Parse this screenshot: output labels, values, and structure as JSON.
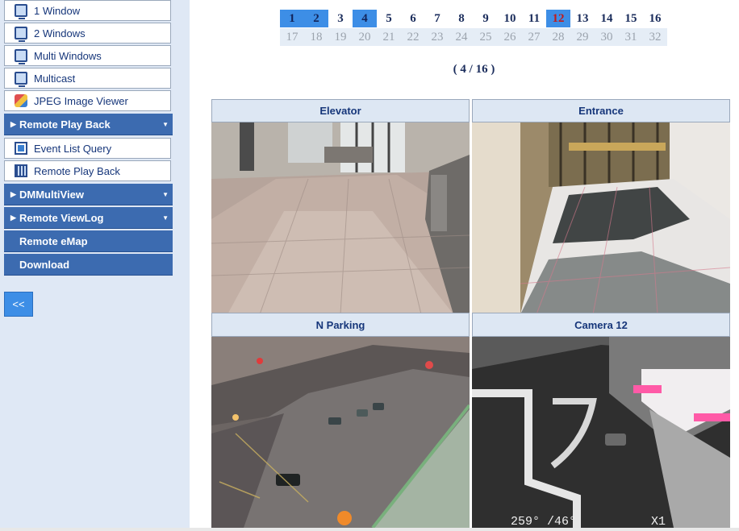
{
  "sidebar": {
    "items_top": [
      {
        "label": "1 Window",
        "icon": "monitor-icon"
      },
      {
        "label": "2 Windows",
        "icon": "monitor-icon"
      },
      {
        "label": "Multi Windows",
        "icon": "monitor-icon"
      },
      {
        "label": "Multicast",
        "icon": "monitor-icon"
      },
      {
        "label": "JPEG Image Viewer",
        "icon": "jpeg-icon"
      }
    ],
    "remote_play_back_header": "Remote Play Back",
    "remote_play_back_items": [
      {
        "label": "Event List Query",
        "icon": "event-icon"
      },
      {
        "label": "Remote Play Back",
        "icon": "film-icon"
      }
    ],
    "dmmultiview_header": "DMMultiView",
    "remote_viewlog_header": "Remote ViewLog",
    "remote_emap": "Remote eMap",
    "download": "Download",
    "collapse_button": "<<"
  },
  "pager": {
    "row1": [
      "1",
      "2",
      "3",
      "4",
      "5",
      "6",
      "7",
      "8",
      "9",
      "10",
      "11",
      "12",
      "13",
      "14",
      "15",
      "16"
    ],
    "row2": [
      "17",
      "18",
      "19",
      "20",
      "21",
      "22",
      "23",
      "24",
      "25",
      "26",
      "27",
      "28",
      "29",
      "30",
      "31",
      "32"
    ],
    "selected": [
      "1",
      "2",
      "4"
    ],
    "current": "12"
  },
  "page_indicator": "( 4 / 16 )",
  "cameras": [
    {
      "title": "Elevator"
    },
    {
      "title": "Entrance"
    },
    {
      "title": "N Parking"
    },
    {
      "title": "Camera 12",
      "osd_left": "259° /46°",
      "osd_right": "X1"
    }
  ],
  "colors": {
    "accent": "#3c6bb0",
    "selected_page": "#3d8ee6",
    "current_page_text": "#c21a1a",
    "sidebar_bg": "#dfe8f5"
  }
}
